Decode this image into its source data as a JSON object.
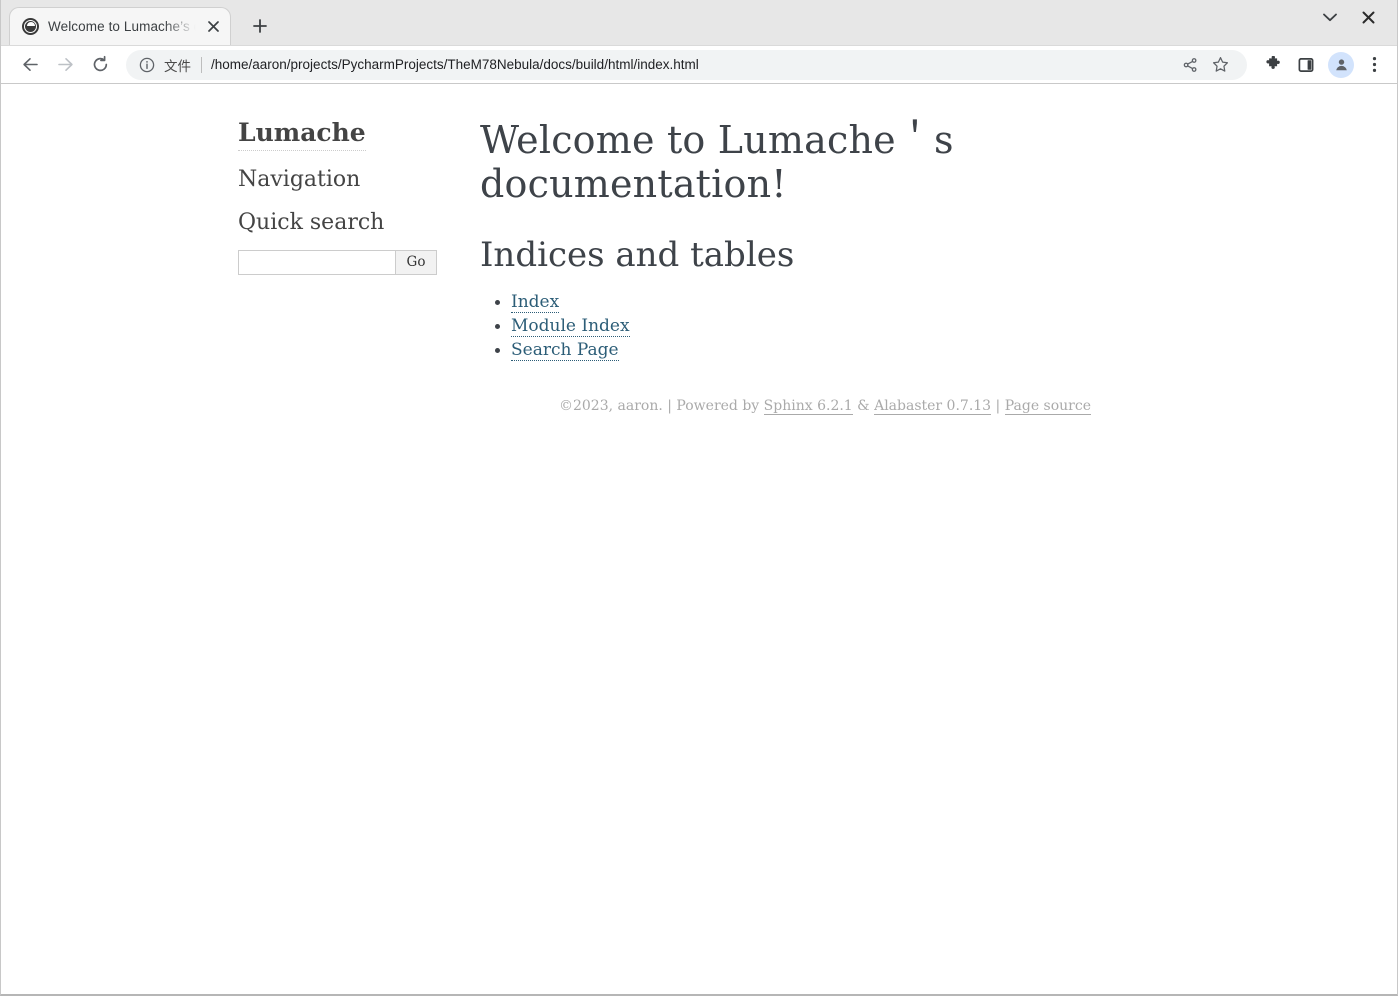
{
  "browser": {
    "tab": {
      "title": "Welcome to Lumache’s documentation!",
      "favicon_name": "globe-favicon",
      "close_label": "×"
    },
    "new_tab_label": "+",
    "window_controls": {
      "minimize_label": "⌄",
      "close_label": "×"
    },
    "toolbar": {
      "back_label": "←",
      "forward_label": "→",
      "reload_label": "↻",
      "site_info_icon": "info-circle-icon",
      "scheme_label": "文件",
      "url": "/home/aaron/projects/PycharmProjects/TheM78Nebula/docs/build/html/index.html",
      "share_icon": "share-icon",
      "bookmark_icon": "star-icon",
      "extensions_icon": "puzzle-piece-icon",
      "side_panel_icon": "side-panel-icon",
      "profile_icon": "profile-avatar-icon",
      "menu_icon": "three-dot-menu-icon"
    }
  },
  "page": {
    "sidebar": {
      "logo": "Lumache",
      "navigation_heading": "Navigation",
      "quick_search_heading": "Quick search",
      "search_value": "",
      "search_placeholder": "",
      "search_button_label": "Go"
    },
    "main": {
      "title": "Welcome to Lumache＇s documentation!",
      "section_heading": "Indices and tables",
      "links": [
        {
          "label": "Index"
        },
        {
          "label": "Module Index"
        },
        {
          "label": "Search Page"
        }
      ]
    },
    "footer": {
      "copyright": "©2023, aaron. | Powered by ",
      "sphinx_link": "Sphinx 6.2.1",
      "amp": " & ",
      "alabaster_link": "Alabaster 0.7.13",
      "separator": " | ",
      "page_source_link": "Page source"
    }
  },
  "colors": {
    "link": "#2c5d77",
    "heading": "#3e4349",
    "footer_text": "#aaaaaa",
    "tab_strip": "#e7e7e7",
    "omnibox": "#f1f3f4"
  }
}
